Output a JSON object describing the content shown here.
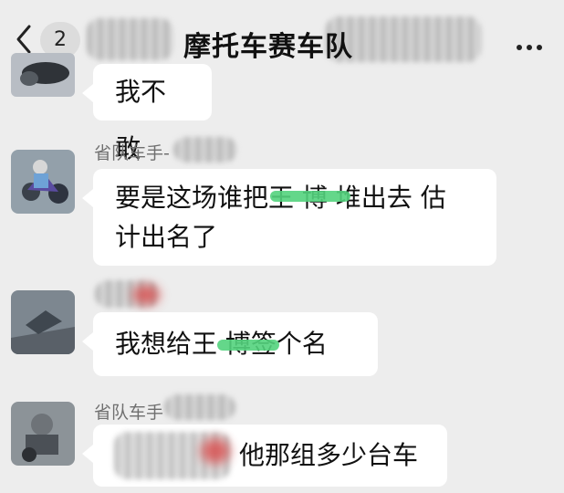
{
  "header": {
    "back_icon": "chevron-left-icon",
    "unread_count": "2",
    "title": "摩托车赛车队",
    "more_icon": "more-horizontal-icon"
  },
  "messages": [
    {
      "sender": "",
      "text": "我不敢"
    },
    {
      "sender": "省队车手-",
      "text_line1": "要是这场谁把王   博 堆出去 估",
      "text_line2": "计出名了"
    },
    {
      "sender": "",
      "text": "我想给王   博签个名"
    },
    {
      "sender": "省队车手",
      "text": "他那组多少台车"
    }
  ]
}
